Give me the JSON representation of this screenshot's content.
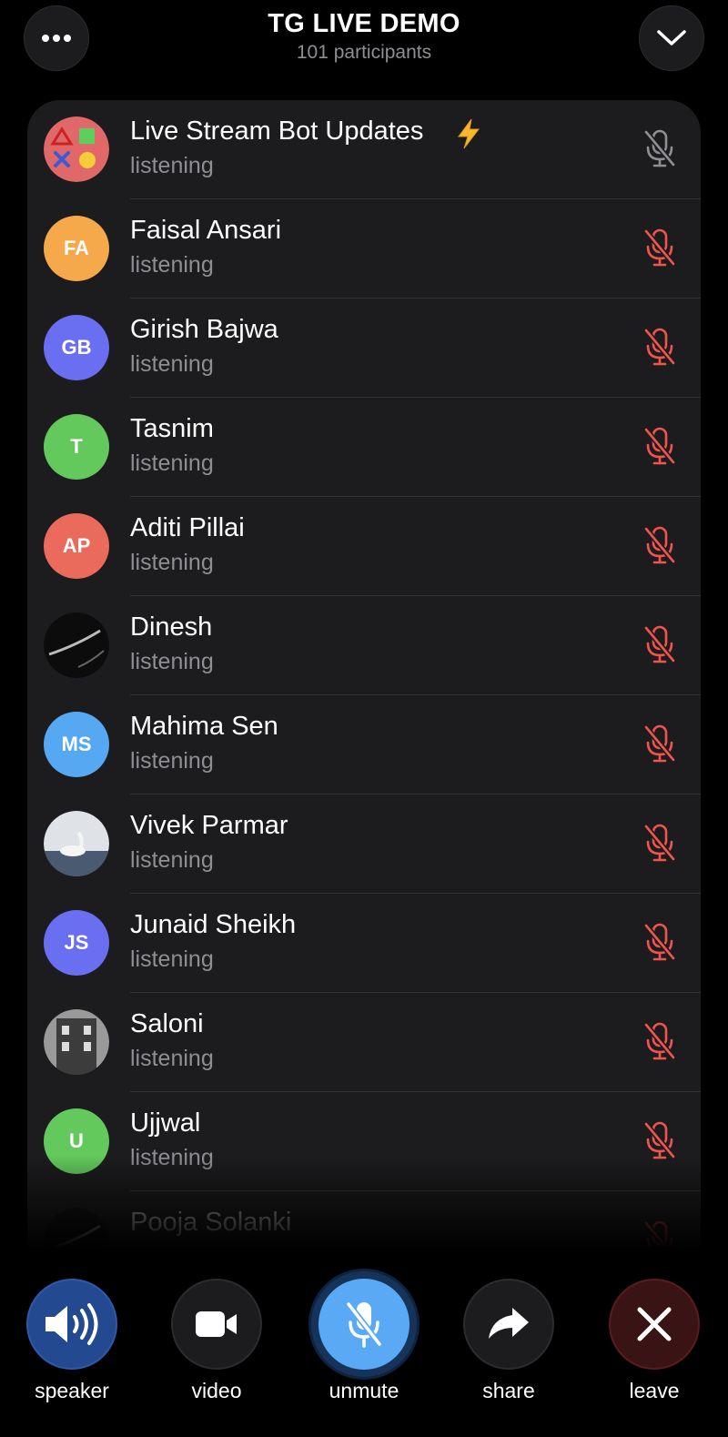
{
  "header": {
    "title": "TG LIVE DEMO",
    "subtitle": "101 participants",
    "more_icon": "more-dots-icon",
    "collapse_icon": "chevron-down-icon"
  },
  "participants": [
    {
      "name": "Live Stream Bot Updates",
      "status": "listening",
      "avatar_kind": "shapes",
      "muted_color": "#8e8e93"
    },
    {
      "name": "Faisal Ansari",
      "status": "listening",
      "initials": "FA",
      "avatar_color": "#f6a94a",
      "muted_color": "#f0544c"
    },
    {
      "name": "Girish Bajwa",
      "status": "listening",
      "initials": "GB",
      "avatar_color": "#6a6ef0",
      "muted_color": "#f0544c"
    },
    {
      "name": "Tasnim",
      "status": "listening",
      "initials": "T",
      "avatar_color": "#63c95c",
      "muted_color": "#f0544c"
    },
    {
      "name": "Aditi Pillai",
      "status": "listening",
      "initials": "AP",
      "avatar_color": "#ea6a5c",
      "muted_color": "#f0544c"
    },
    {
      "name": "Dinesh",
      "status": "listening",
      "avatar_kind": "photo-dark",
      "muted_color": "#f0544c"
    },
    {
      "name": "Mahima Sen",
      "status": "listening",
      "initials": "MS",
      "avatar_color": "#56a8f2",
      "muted_color": "#f0544c"
    },
    {
      "name": "Vivek Parmar",
      "status": "listening",
      "avatar_kind": "photo-swan",
      "muted_color": "#f0544c"
    },
    {
      "name": "Junaid Sheikh",
      "status": "listening",
      "initials": "JS",
      "avatar_color": "#6a6ef0",
      "muted_color": "#f0544c"
    },
    {
      "name": "Saloni",
      "status": "listening",
      "avatar_kind": "photo-building",
      "muted_color": "#f0544c"
    },
    {
      "name": "Ujjwal",
      "status": "listening",
      "initials": "U",
      "avatar_color": "#63c95c",
      "muted_color": "#f0544c"
    },
    {
      "name": "Pooja Solanki",
      "status": "",
      "avatar_kind": "photo-dark",
      "muted_color": "#f0544c"
    }
  ],
  "controls": {
    "speaker_label": "speaker",
    "video_label": "video",
    "unmute_label": "unmute",
    "share_label": "share",
    "leave_label": "leave"
  },
  "colors": {
    "accent_blue": "#5aa9f5",
    "mute_red": "#f0544c",
    "leave_red": "#e8584d"
  }
}
